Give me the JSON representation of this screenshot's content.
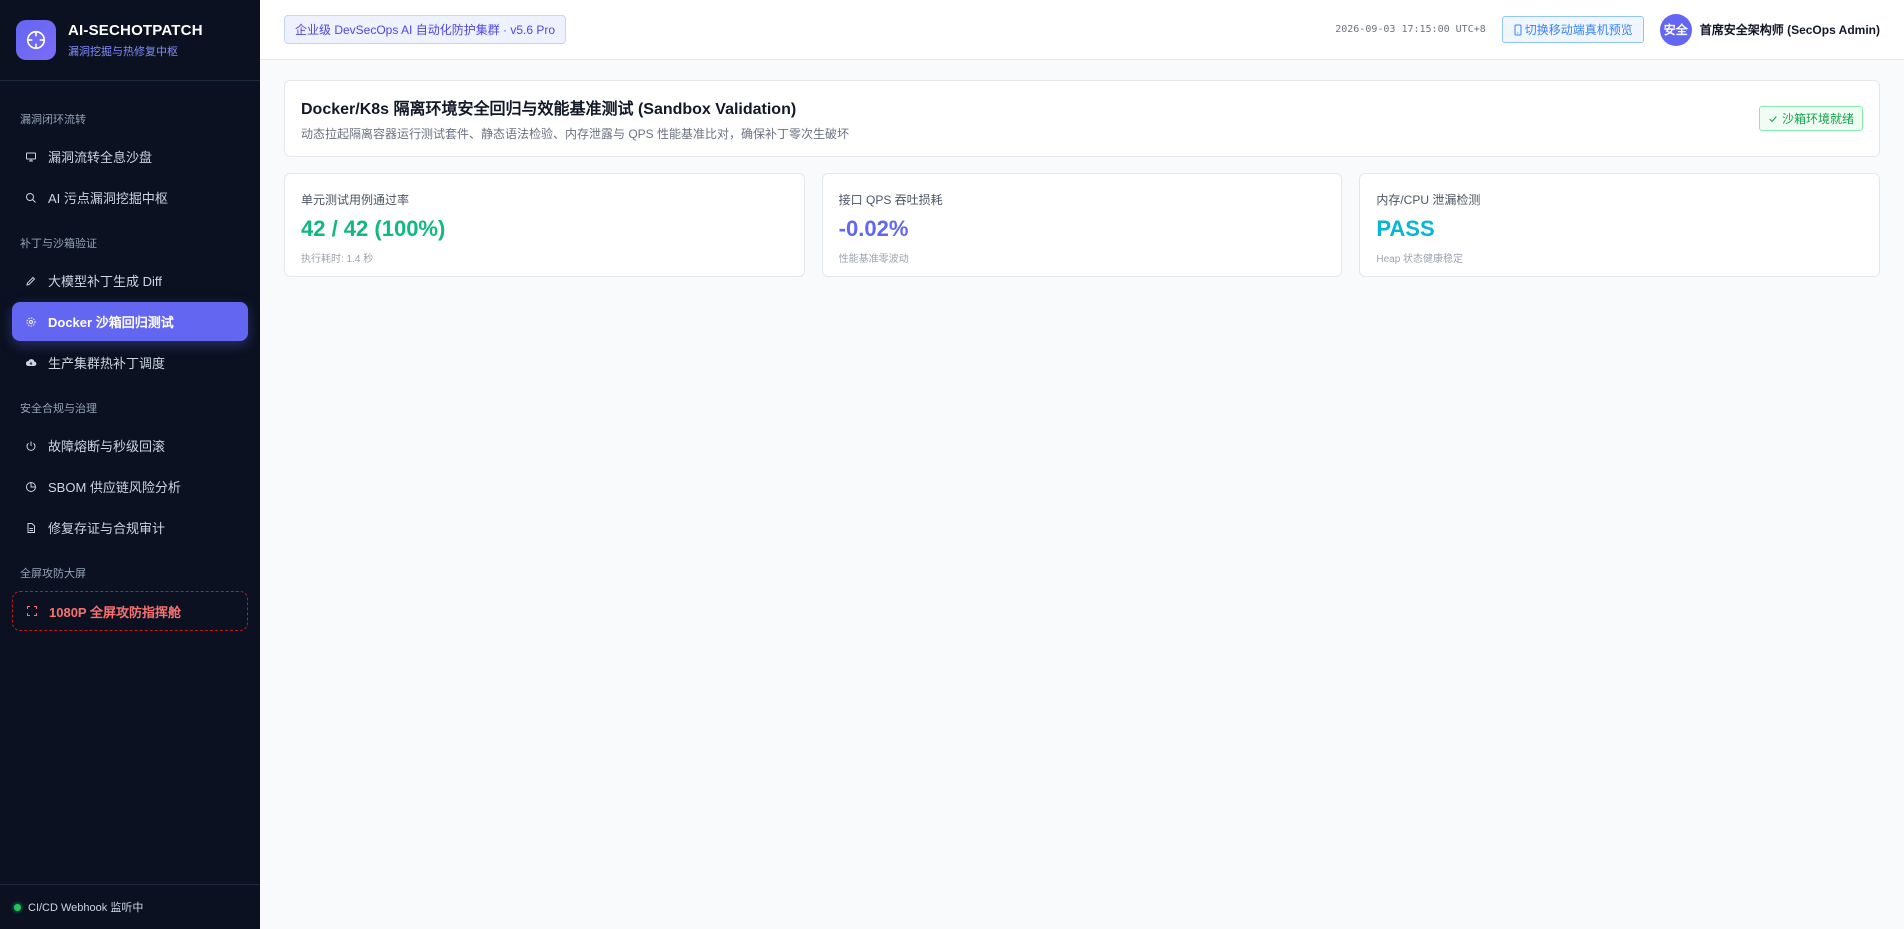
{
  "brand": {
    "title": "AI-SECHOTPATCH",
    "subtitle": "漏洞挖掘与热修复中枢"
  },
  "sidebar": {
    "sections": [
      {
        "label": "漏洞闭环流转",
        "items": [
          {
            "label": "漏洞流转全息沙盘",
            "icon": "monitor-icon"
          },
          {
            "label": "AI 污点漏洞挖掘中枢",
            "icon": "search-icon"
          }
        ]
      },
      {
        "label": "补丁与沙箱验证",
        "items": [
          {
            "label": "大模型补丁生成 Diff",
            "icon": "pencil-icon"
          },
          {
            "label": "Docker 沙箱回归测试",
            "icon": "gear-icon",
            "active": true
          },
          {
            "label": "生产集群热补丁调度",
            "icon": "cloud-upload-icon"
          }
        ]
      },
      {
        "label": "安全合规与治理",
        "items": [
          {
            "label": "故障熔断与秒级回滚",
            "icon": "power-icon"
          },
          {
            "label": "SBOM 供应链风险分析",
            "icon": "pie-chart-icon"
          },
          {
            "label": "修复存证与合规审计",
            "icon": "document-icon"
          }
        ]
      },
      {
        "label": "全屏攻防大屏",
        "items": [
          {
            "label": "1080P 全屏攻防指挥舱",
            "icon": "fullscreen-icon",
            "danger": true
          }
        ]
      }
    ],
    "footer_status": "CI/CD Webhook 监听中"
  },
  "topbar": {
    "edition": "企业级 DevSecOps AI 自动化防护集群 · v5.6 Pro",
    "clock": "2026-09-03 17:15:00 UTC+8",
    "mobile_button": "切换移动端真机预览",
    "avatar_text": "安全",
    "user_name": "首席安全架构师 (SecOps Admin)"
  },
  "page": {
    "title": "Docker/K8s 隔离环境安全回归与效能基准测试 (Sandbox Validation)",
    "description": "动态拉起隔离容器运行测试套件、静态语法检验、内存泄露与 QPS 性能基准比对，确保补丁零次生破坏",
    "env_tag": "沙箱环境就绪"
  },
  "stats": [
    {
      "label": "单元测试用例通过率",
      "value": "42 / 42 (100%)",
      "note": "执行耗时: 1.4 秒",
      "color": "#10b981"
    },
    {
      "label": "接口 QPS 吞吐损耗",
      "value": "-0.02%",
      "note": "性能基准零波动",
      "color": "#6366f1"
    },
    {
      "label": "内存/CPU 泄漏检测",
      "value": "PASS",
      "note": "Heap 状态健康稳定",
      "color": "#06b6d4"
    }
  ],
  "colors": {
    "accent": "#6366f1",
    "sidebar_bg": "#0b1120",
    "success": "#10b981",
    "danger": "#f87171"
  }
}
